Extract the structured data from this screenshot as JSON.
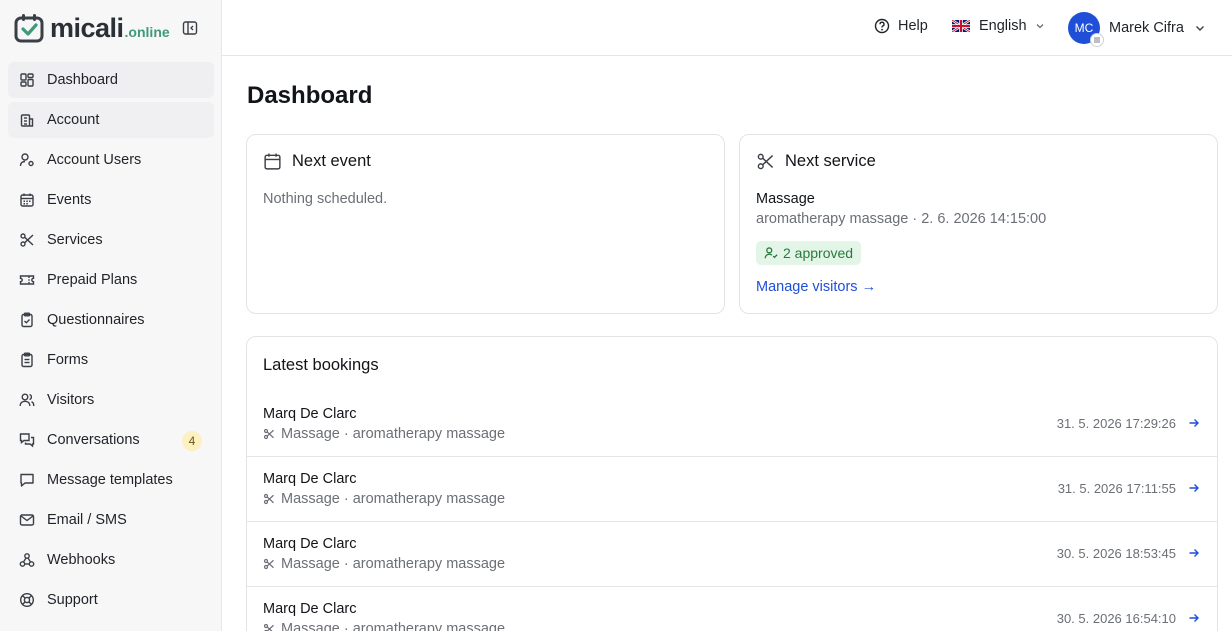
{
  "brand": {
    "name": "micali",
    "tld": ".online"
  },
  "sidebar": {
    "items": [
      {
        "label": "Dashboard",
        "icon": "dashboard-icon"
      },
      {
        "label": "Account",
        "icon": "building-icon"
      },
      {
        "label": "Account Users",
        "icon": "user-cog-icon"
      },
      {
        "label": "Events",
        "icon": "calendar-icon"
      },
      {
        "label": "Services",
        "icon": "scissors-icon"
      },
      {
        "label": "Prepaid Plans",
        "icon": "ticket-icon"
      },
      {
        "label": "Questionnaires",
        "icon": "clipboard-check-icon"
      },
      {
        "label": "Forms",
        "icon": "clipboard-list-icon"
      },
      {
        "label": "Visitors",
        "icon": "users-icon"
      },
      {
        "label": "Conversations",
        "icon": "messages-icon",
        "badge": "4"
      },
      {
        "label": "Message templates",
        "icon": "message-square-icon"
      },
      {
        "label": "Email / SMS",
        "icon": "mail-icon"
      },
      {
        "label": "Webhooks",
        "icon": "webhook-icon"
      },
      {
        "label": "Support",
        "icon": "lifebuoy-icon"
      }
    ]
  },
  "topbar": {
    "help": "Help",
    "language": "English",
    "user": {
      "initials": "MC",
      "name": "Marek Cifra"
    }
  },
  "page": {
    "title": "Dashboard"
  },
  "next_event": {
    "title": "Next event",
    "empty": "Nothing scheduled."
  },
  "next_service": {
    "title": "Next service",
    "name": "Massage",
    "details": "aromatherapy massage · 2. 6. 2026 14:15:00",
    "approved": "2 approved",
    "manage_link": "Manage visitors →"
  },
  "latest_bookings": {
    "title": "Latest bookings",
    "rows": [
      {
        "name": "Marq De Clarc",
        "service": "Massage · aromatherapy massage",
        "time": "31. 5. 2026 17:29:26"
      },
      {
        "name": "Marq De Clarc",
        "service": "Massage · aromatherapy massage",
        "time": "31. 5. 2026 17:11:55"
      },
      {
        "name": "Marq De Clarc",
        "service": "Massage · aromatherapy massage",
        "time": "30. 5. 2026 18:53:45"
      },
      {
        "name": "Marq De Clarc",
        "service": "Massage · aromatherapy massage",
        "time": "30. 5. 2026 16:54:10"
      }
    ]
  },
  "colors": {
    "accent": "#1f4fd6",
    "brand_green": "#3f9a7a",
    "approved_bg": "#e2f5e7",
    "badge_bg": "#fdf0c2"
  }
}
